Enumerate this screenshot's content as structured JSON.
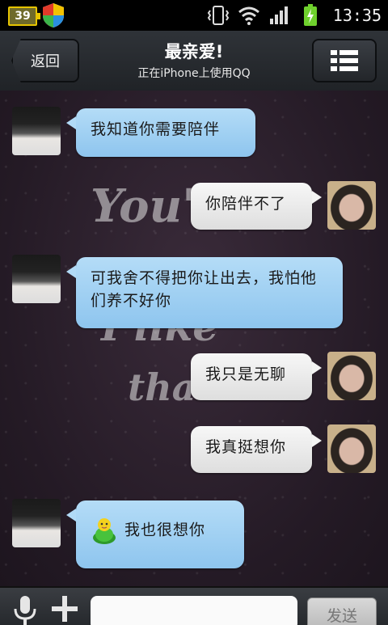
{
  "status_bar": {
    "battery_percent": "39",
    "time": "13:35",
    "icons": [
      "shield-icon",
      "vibrate-icon",
      "wifi-icon",
      "signal-icon",
      "charging-battery-icon"
    ]
  },
  "header": {
    "back_label": "返回",
    "title": "最亲爱!",
    "subtitle": "正在iPhone上使用QQ",
    "menu_icon": "profile-menu-icon"
  },
  "background": {
    "text_lines": [
      "You'r",
      "I like",
      "tha"
    ]
  },
  "messages": [
    {
      "side": "left",
      "text": "我知道你需要陪伴"
    },
    {
      "side": "right",
      "text": "你陪伴不了"
    },
    {
      "side": "left",
      "text": "可我舍不得把你让出去，我怕他们养不好你"
    },
    {
      "side": "right",
      "text": "我只是无聊"
    },
    {
      "side": "right",
      "text": "我真挺想你"
    },
    {
      "side": "left",
      "text": "我也很想你",
      "emoji": "green-qq-mascot-icon"
    }
  ],
  "input_bar": {
    "input_value": "",
    "send_label": "发送",
    "icons": [
      "microphone-icon",
      "plus-icon"
    ]
  },
  "colors": {
    "incoming_bubble": "#a6d3f3",
    "outgoing_bubble": "#ececec",
    "title_bar": "#2a2d31"
  }
}
